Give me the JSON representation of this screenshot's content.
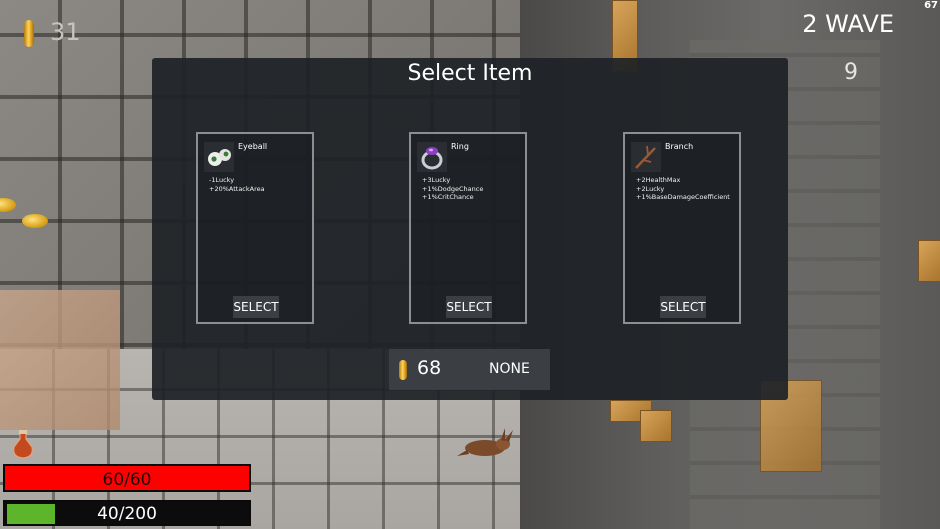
{
  "hud": {
    "coins": "31",
    "fps": "67",
    "wave_label": "2 WAVE",
    "wave_count": "9"
  },
  "modal": {
    "title": "Select Item",
    "items": [
      {
        "name": "Eyeball",
        "icon": "eyeball-icon",
        "stats": [
          "-1Lucky",
          "+20%AttackArea"
        ],
        "button": "SELECT"
      },
      {
        "name": "Ring",
        "icon": "ring-icon",
        "stats": [
          "+3Lucky",
          "+1%DodgeChance",
          "+1%CritChance"
        ],
        "button": "SELECT"
      },
      {
        "name": "Branch",
        "icon": "branch-icon",
        "stats": [
          "+2HealthMax",
          "+2Lucky",
          "+1%BaseDamageCoefficient"
        ],
        "button": "SELECT"
      }
    ],
    "coins": "68",
    "none_label": "NONE"
  },
  "player": {
    "health_text": "60/60",
    "health_fraction": 1.0,
    "xp_text": "40/200",
    "xp_fraction": 0.2
  },
  "colors": {
    "health": "#ff0000",
    "xp": "#5cb52b",
    "panel": "#1e2227",
    "button": "#3b3f44"
  }
}
